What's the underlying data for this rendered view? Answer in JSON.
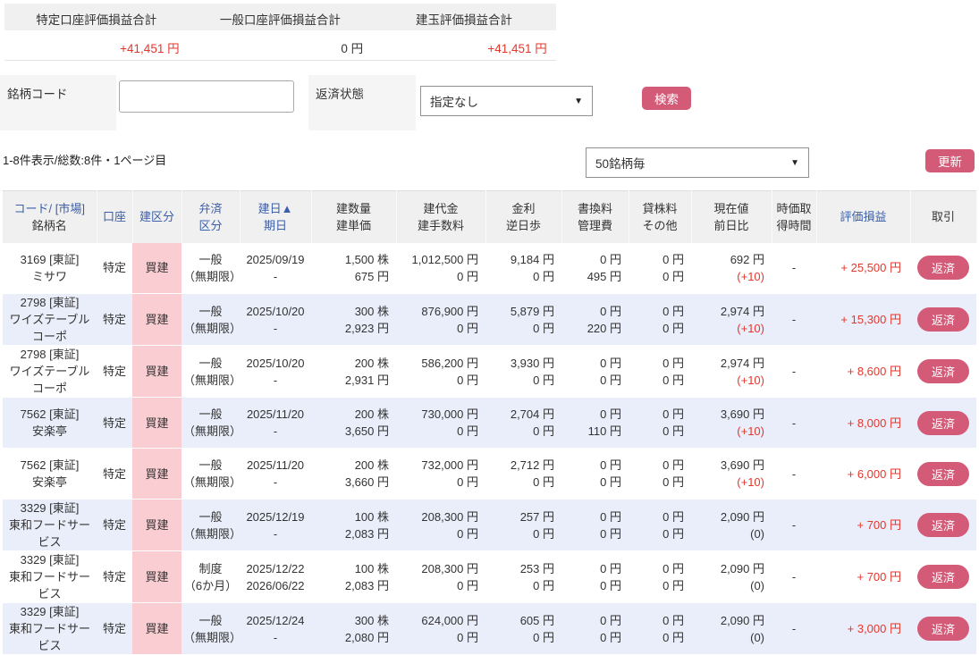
{
  "summary": {
    "items": [
      {
        "label": "特定口座評価損益合計",
        "value": "+41,451 円",
        "color": "red"
      },
      {
        "label": "一般口座評価損益合計",
        "value": "0 円",
        "color": "dark"
      },
      {
        "label": "建玉評価損益合計",
        "value": "+41,451 円",
        "color": "red"
      }
    ]
  },
  "filters": {
    "code_label": "銘柄コード",
    "code_value": "",
    "status_label": "返済状態",
    "status_selected": "指定なし",
    "search_button": "検索"
  },
  "listinfo": {
    "pagination": "1-8件表示/総数:8件・1ページ目",
    "per_page_selected": "50銘柄毎",
    "refresh_button": "更新"
  },
  "icons": {
    "chevron_down": "▼",
    "sort_asc": "▲"
  },
  "table": {
    "headers": [
      {
        "line1": "コード/ [市場]",
        "line2": "銘柄名",
        "blue1": true,
        "blue2": false,
        "sortable": true
      },
      {
        "line1": "口座",
        "line2": "",
        "blue1": true,
        "blue2": false,
        "sortable": true
      },
      {
        "line1": "建区分",
        "line2": "",
        "blue1": true,
        "blue2": false,
        "sortable": true
      },
      {
        "line1": "弁済",
        "line2": "区分",
        "blue1": true,
        "blue2": true,
        "sortable": true
      },
      {
        "line1": "建日▲",
        "line2": "期日",
        "blue1": true,
        "blue2": true,
        "sortable": true
      },
      {
        "line1": "建数量",
        "line2": "建単価",
        "blue1": false,
        "blue2": false,
        "sortable": false
      },
      {
        "line1": "建代金",
        "line2": "建手数料",
        "blue1": false,
        "blue2": false,
        "sortable": false
      },
      {
        "line1": "金利",
        "line2": "逆日歩",
        "blue1": false,
        "blue2": false,
        "sortable": false
      },
      {
        "line1": "書換料",
        "line2": "管理費",
        "blue1": false,
        "blue2": false,
        "sortable": false
      },
      {
        "line1": "貸株料",
        "line2": "その他",
        "blue1": false,
        "blue2": false,
        "sortable": false
      },
      {
        "line1": "現在値",
        "line2": "前日比",
        "blue1": false,
        "blue2": false,
        "sortable": false
      },
      {
        "line1": "時価取",
        "line2": "得時間",
        "blue1": false,
        "blue2": false,
        "sortable": false
      },
      {
        "line1": "評価損益",
        "line2": "",
        "blue1": true,
        "blue2": false,
        "sortable": true
      },
      {
        "line1": "取引",
        "line2": "",
        "blue1": false,
        "blue2": false,
        "sortable": false
      }
    ],
    "rows": [
      {
        "code": "3169 [東証]",
        "name": "ミサワ",
        "account": "特定",
        "trade_type": "買建",
        "repay_type": "一般",
        "repay_term": "（無期限）",
        "open_date": "2025/09/19",
        "due_date": "-",
        "qty": "1,500 株",
        "unit_price": "675 円",
        "amount": "1,012,500 円",
        "fee": "0 円",
        "interest": "9,184 円",
        "neg_interest": "0 円",
        "rewrite_fee": "0 円",
        "mgmt_fee": "495 円",
        "lend_fee": "0 円",
        "other": "0 円",
        "price": "692 円",
        "change": "(+10)",
        "change_color": "red",
        "time": "-",
        "pl": "+ 25,500 円",
        "action": "返済"
      },
      {
        "code": "2798 [東証]",
        "name": "ワイズテーブルコーポ",
        "account": "特定",
        "trade_type": "買建",
        "repay_type": "一般",
        "repay_term": "（無期限）",
        "open_date": "2025/10/20",
        "due_date": "-",
        "qty": "300 株",
        "unit_price": "2,923 円",
        "amount": "876,900 円",
        "fee": "0 円",
        "interest": "5,879 円",
        "neg_interest": "0 円",
        "rewrite_fee": "0 円",
        "mgmt_fee": "220 円",
        "lend_fee": "0 円",
        "other": "0 円",
        "price": "2,974 円",
        "change": "(+10)",
        "change_color": "red",
        "time": "-",
        "pl": "+ 15,300 円",
        "action": "返済"
      },
      {
        "code": "2798 [東証]",
        "name": "ワイズテーブルコーポ",
        "account": "特定",
        "trade_type": "買建",
        "repay_type": "一般",
        "repay_term": "（無期限）",
        "open_date": "2025/10/20",
        "due_date": "-",
        "qty": "200 株",
        "unit_price": "2,931 円",
        "amount": "586,200 円",
        "fee": "0 円",
        "interest": "3,930 円",
        "neg_interest": "0 円",
        "rewrite_fee": "0 円",
        "mgmt_fee": "0 円",
        "lend_fee": "0 円",
        "other": "0 円",
        "price": "2,974 円",
        "change": "(+10)",
        "change_color": "red",
        "time": "-",
        "pl": "+ 8,600 円",
        "action": "返済"
      },
      {
        "code": "7562 [東証]",
        "name": "安楽亭",
        "account": "特定",
        "trade_type": "買建",
        "repay_type": "一般",
        "repay_term": "（無期限）",
        "open_date": "2025/11/20",
        "due_date": "-",
        "qty": "200 株",
        "unit_price": "3,650 円",
        "amount": "730,000 円",
        "fee": "0 円",
        "interest": "2,704 円",
        "neg_interest": "0 円",
        "rewrite_fee": "0 円",
        "mgmt_fee": "110 円",
        "lend_fee": "0 円",
        "other": "0 円",
        "price": "3,690 円",
        "change": "(+10)",
        "change_color": "red",
        "time": "-",
        "pl": "+ 8,000 円",
        "action": "返済"
      },
      {
        "code": "7562 [東証]",
        "name": "安楽亭",
        "account": "特定",
        "trade_type": "買建",
        "repay_type": "一般",
        "repay_term": "（無期限）",
        "open_date": "2025/11/20",
        "due_date": "-",
        "qty": "200 株",
        "unit_price": "3,660 円",
        "amount": "732,000 円",
        "fee": "0 円",
        "interest": "2,712 円",
        "neg_interest": "0 円",
        "rewrite_fee": "0 円",
        "mgmt_fee": "0 円",
        "lend_fee": "0 円",
        "other": "0 円",
        "price": "3,690 円",
        "change": "(+10)",
        "change_color": "red",
        "time": "-",
        "pl": "+ 6,000 円",
        "action": "返済"
      },
      {
        "code": "3329 [東証]",
        "name": "東和フードサービス",
        "account": "特定",
        "trade_type": "買建",
        "repay_type": "一般",
        "repay_term": "（無期限）",
        "open_date": "2025/12/19",
        "due_date": "-",
        "qty": "100 株",
        "unit_price": "2,083 円",
        "amount": "208,300 円",
        "fee": "0 円",
        "interest": "257 円",
        "neg_interest": "0 円",
        "rewrite_fee": "0 円",
        "mgmt_fee": "0 円",
        "lend_fee": "0 円",
        "other": "0 円",
        "price": "2,090 円",
        "change": "(0)",
        "change_color": "dark",
        "time": "-",
        "pl": "+ 700 円",
        "action": "返済"
      },
      {
        "code": "3329 [東証]",
        "name": "東和フードサービス",
        "account": "特定",
        "trade_type": "買建",
        "repay_type": "制度",
        "repay_term": "（6か月）",
        "open_date": "2025/12/22",
        "due_date": "2026/06/22",
        "qty": "100 株",
        "unit_price": "2,083 円",
        "amount": "208,300 円",
        "fee": "0 円",
        "interest": "253 円",
        "neg_interest": "0 円",
        "rewrite_fee": "0 円",
        "mgmt_fee": "0 円",
        "lend_fee": "0 円",
        "other": "0 円",
        "price": "2,090 円",
        "change": "(0)",
        "change_color": "dark",
        "time": "-",
        "pl": "+ 700 円",
        "action": "返済"
      },
      {
        "code": "3329 [東証]",
        "name": "東和フードサービス",
        "account": "特定",
        "trade_type": "買建",
        "repay_type": "一般",
        "repay_term": "（無期限）",
        "open_date": "2025/12/24",
        "due_date": "-",
        "qty": "300 株",
        "unit_price": "2,080 円",
        "amount": "624,000 円",
        "fee": "0 円",
        "interest": "605 円",
        "neg_interest": "0 円",
        "rewrite_fee": "0 円",
        "mgmt_fee": "0 円",
        "lend_fee": "0 円",
        "other": "0 円",
        "price": "2,090 円",
        "change": "(0)",
        "change_color": "dark",
        "time": "-",
        "pl": "+ 3,000 円",
        "action": "返済"
      }
    ]
  }
}
